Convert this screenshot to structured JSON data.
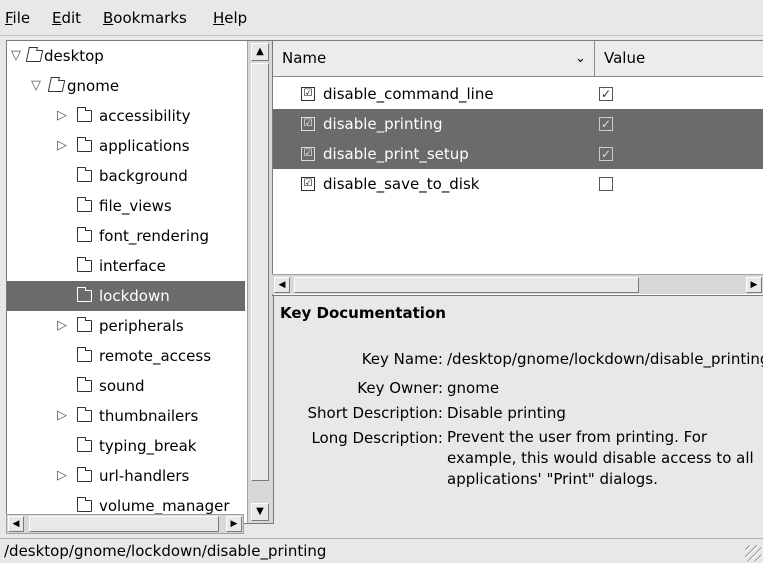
{
  "menubar": {
    "items": [
      {
        "mnemonic": "F",
        "rest": "ile"
      },
      {
        "mnemonic": "E",
        "rest": "dit"
      },
      {
        "mnemonic": "B",
        "rest": "ookmarks"
      },
      {
        "mnemonic": "H",
        "rest": "elp"
      }
    ]
  },
  "tree": {
    "root": {
      "label": "desktop",
      "expanded": true
    },
    "gnome": {
      "label": "gnome",
      "expanded": true
    },
    "children": [
      {
        "label": "accessibility",
        "expandable": true
      },
      {
        "label": "applications",
        "expandable": true
      },
      {
        "label": "background",
        "expandable": false
      },
      {
        "label": "file_views",
        "expandable": false
      },
      {
        "label": "font_rendering",
        "expandable": false
      },
      {
        "label": "interface",
        "expandable": false
      },
      {
        "label": "lockdown",
        "expandable": false,
        "selected": true
      },
      {
        "label": "peripherals",
        "expandable": true
      },
      {
        "label": "remote_access",
        "expandable": false
      },
      {
        "label": "sound",
        "expandable": false
      },
      {
        "label": "thumbnailers",
        "expandable": true
      },
      {
        "label": "typing_break",
        "expandable": false
      },
      {
        "label": "url-handlers",
        "expandable": true
      },
      {
        "label": "volume_manager",
        "expandable": false
      }
    ]
  },
  "keylist": {
    "columns": {
      "name": "Name",
      "value": "Value"
    },
    "rows": [
      {
        "name": "disable_command_line",
        "checked": true,
        "selected": false
      },
      {
        "name": "disable_printing",
        "checked": true,
        "selected": true
      },
      {
        "name": "disable_print_setup",
        "checked": true,
        "selected": true
      },
      {
        "name": "disable_save_to_disk",
        "checked": false,
        "selected": false
      }
    ]
  },
  "keydoc": {
    "title": "Key Documentation",
    "key_name_label": "Key Name:",
    "key_name_value": "/desktop/gnome/lockdown/disable_printing",
    "key_owner_label": "Key Owner:",
    "key_owner_value": "gnome",
    "short_desc_label": "Short Description:",
    "short_desc_value": "Disable printing",
    "long_desc_label": "Long Description:",
    "long_desc_value": "Prevent the user from printing. For example, this would disable access to all applications' \"Print\" dialogs."
  },
  "statusbar": {
    "path": "/desktop/gnome/lockdown/disable_printing"
  },
  "icons": {
    "expanded": "triangle-down",
    "collapsed": "triangle-right",
    "folder": "folder-icon",
    "key": "key-entry-icon",
    "check": "✓"
  },
  "colors": {
    "selection": "#6b6b6b",
    "background": "#e8e8e8"
  }
}
